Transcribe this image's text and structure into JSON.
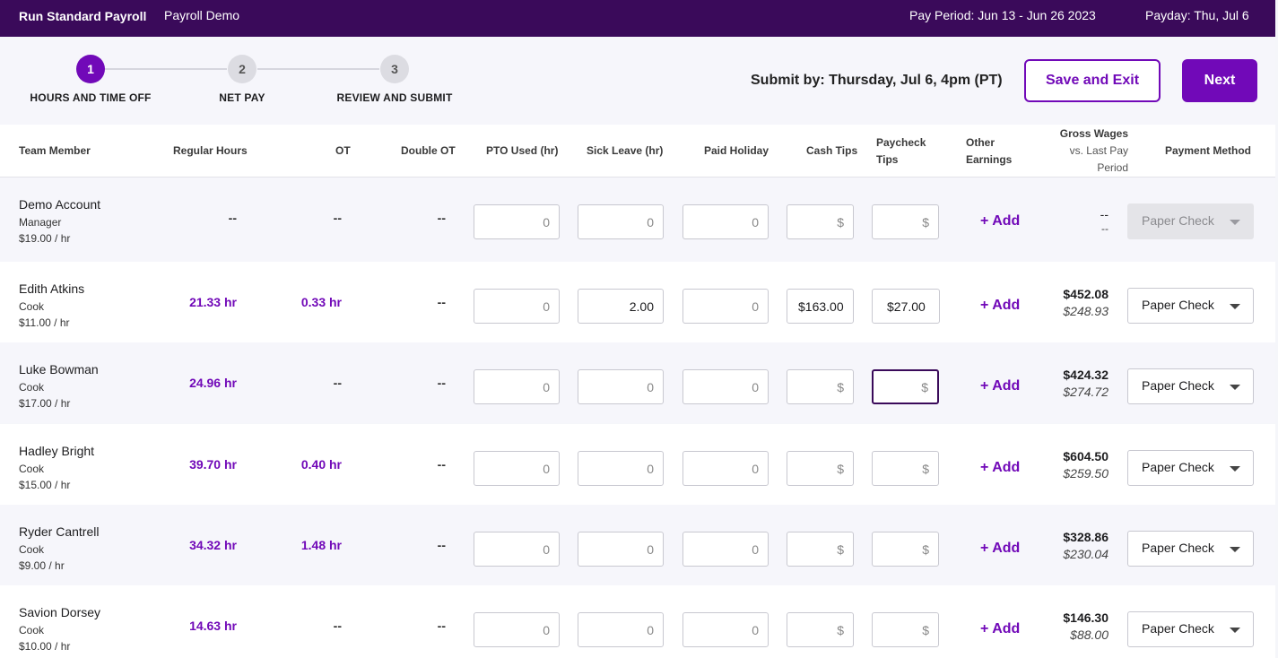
{
  "header": {
    "title": "Run Standard Payroll",
    "company": "Payroll Demo",
    "pay_period": "Pay Period: Jun 13 - Jun 26 2023",
    "payday": "Payday: Thu, Jul 6"
  },
  "stepper": {
    "steps": [
      {
        "number": "1",
        "label": "HOURS AND TIME OFF",
        "state": "active"
      },
      {
        "number": "2",
        "label": "NET PAY",
        "state": "inactive"
      },
      {
        "number": "3",
        "label": "REVIEW AND SUBMIT",
        "state": "inactive"
      }
    ]
  },
  "actions": {
    "submit_by": "Submit by: Thursday, Jul 6, 4pm (PT)",
    "save_exit": "Save and Exit",
    "next": "Next"
  },
  "table": {
    "headers": {
      "team_member": "Team Member",
      "regular_hours": "Regular Hours",
      "ot": "OT",
      "double_ot": "Double OT",
      "pto": "PTO Used (hr)",
      "sick": "Sick Leave (hr)",
      "holiday": "Paid Holiday",
      "cash_tips": "Cash Tips",
      "paycheck_tips_1": "Paycheck",
      "paycheck_tips_2": "Tips",
      "other_1": "Other",
      "other_2": "Earnings",
      "gross_1": "Gross Wages",
      "gross_2": "vs. Last Pay",
      "gross_3": "Period",
      "payment_method": "Payment Method"
    },
    "placeholders": {
      "hours": "0",
      "money": "$"
    },
    "add_label": "+ Add",
    "rows": [
      {
        "name": "Demo Account",
        "role": "Manager",
        "rate": "$19.00 / hr",
        "regular": "--",
        "ot": "--",
        "double_ot": "--",
        "pto": "",
        "sick": "",
        "holiday": "",
        "cash_tips": "",
        "paycheck_tips": "",
        "gross": "--",
        "gross_prev": "--",
        "payment": "Paper Check"
      },
      {
        "name": "Edith Atkins",
        "role": "Cook",
        "rate": "$11.00 / hr",
        "regular": "21.33 hr",
        "ot": "0.33 hr",
        "double_ot": "--",
        "pto": "",
        "sick": "2.00",
        "holiday": "",
        "cash_tips": "$163.00",
        "paycheck_tips": "$27.00",
        "gross": "$452.08",
        "gross_prev": "$248.93",
        "payment": "Paper Check"
      },
      {
        "name": "Luke Bowman",
        "role": "Cook",
        "rate": "$17.00 / hr",
        "regular": "24.96 hr",
        "ot": "--",
        "double_ot": "--",
        "pto": "",
        "sick": "",
        "holiday": "",
        "cash_tips": "",
        "paycheck_tips": "",
        "gross": "$424.32",
        "gross_prev": "$274.72",
        "payment": "Paper Check"
      },
      {
        "name": "Hadley Bright",
        "role": "Cook",
        "rate": "$15.00 / hr",
        "regular": "39.70 hr",
        "ot": "0.40 hr",
        "double_ot": "--",
        "pto": "",
        "sick": "",
        "holiday": "",
        "cash_tips": "",
        "paycheck_tips": "",
        "gross": "$604.50",
        "gross_prev": "$259.50",
        "payment": "Paper Check"
      },
      {
        "name": "Ryder Cantrell",
        "role": "Cook",
        "rate": "$9.00 / hr",
        "regular": "34.32 hr",
        "ot": "1.48 hr",
        "double_ot": "--",
        "pto": "",
        "sick": "",
        "holiday": "",
        "cash_tips": "",
        "paycheck_tips": "",
        "gross": "$328.86",
        "gross_prev": "$230.04",
        "payment": "Paper Check"
      },
      {
        "name": "Savion Dorsey",
        "role": "Cook",
        "rate": "$10.00 / hr",
        "regular": "14.63 hr",
        "ot": "--",
        "double_ot": "--",
        "pto": "",
        "sick": "",
        "holiday": "",
        "cash_tips": "",
        "paycheck_tips": "",
        "gross": "$146.30",
        "gross_prev": "$88.00",
        "payment": "Paper Check"
      }
    ]
  },
  "colors": {
    "brand": "#7109b8",
    "topbar": "#3a0a5a"
  }
}
